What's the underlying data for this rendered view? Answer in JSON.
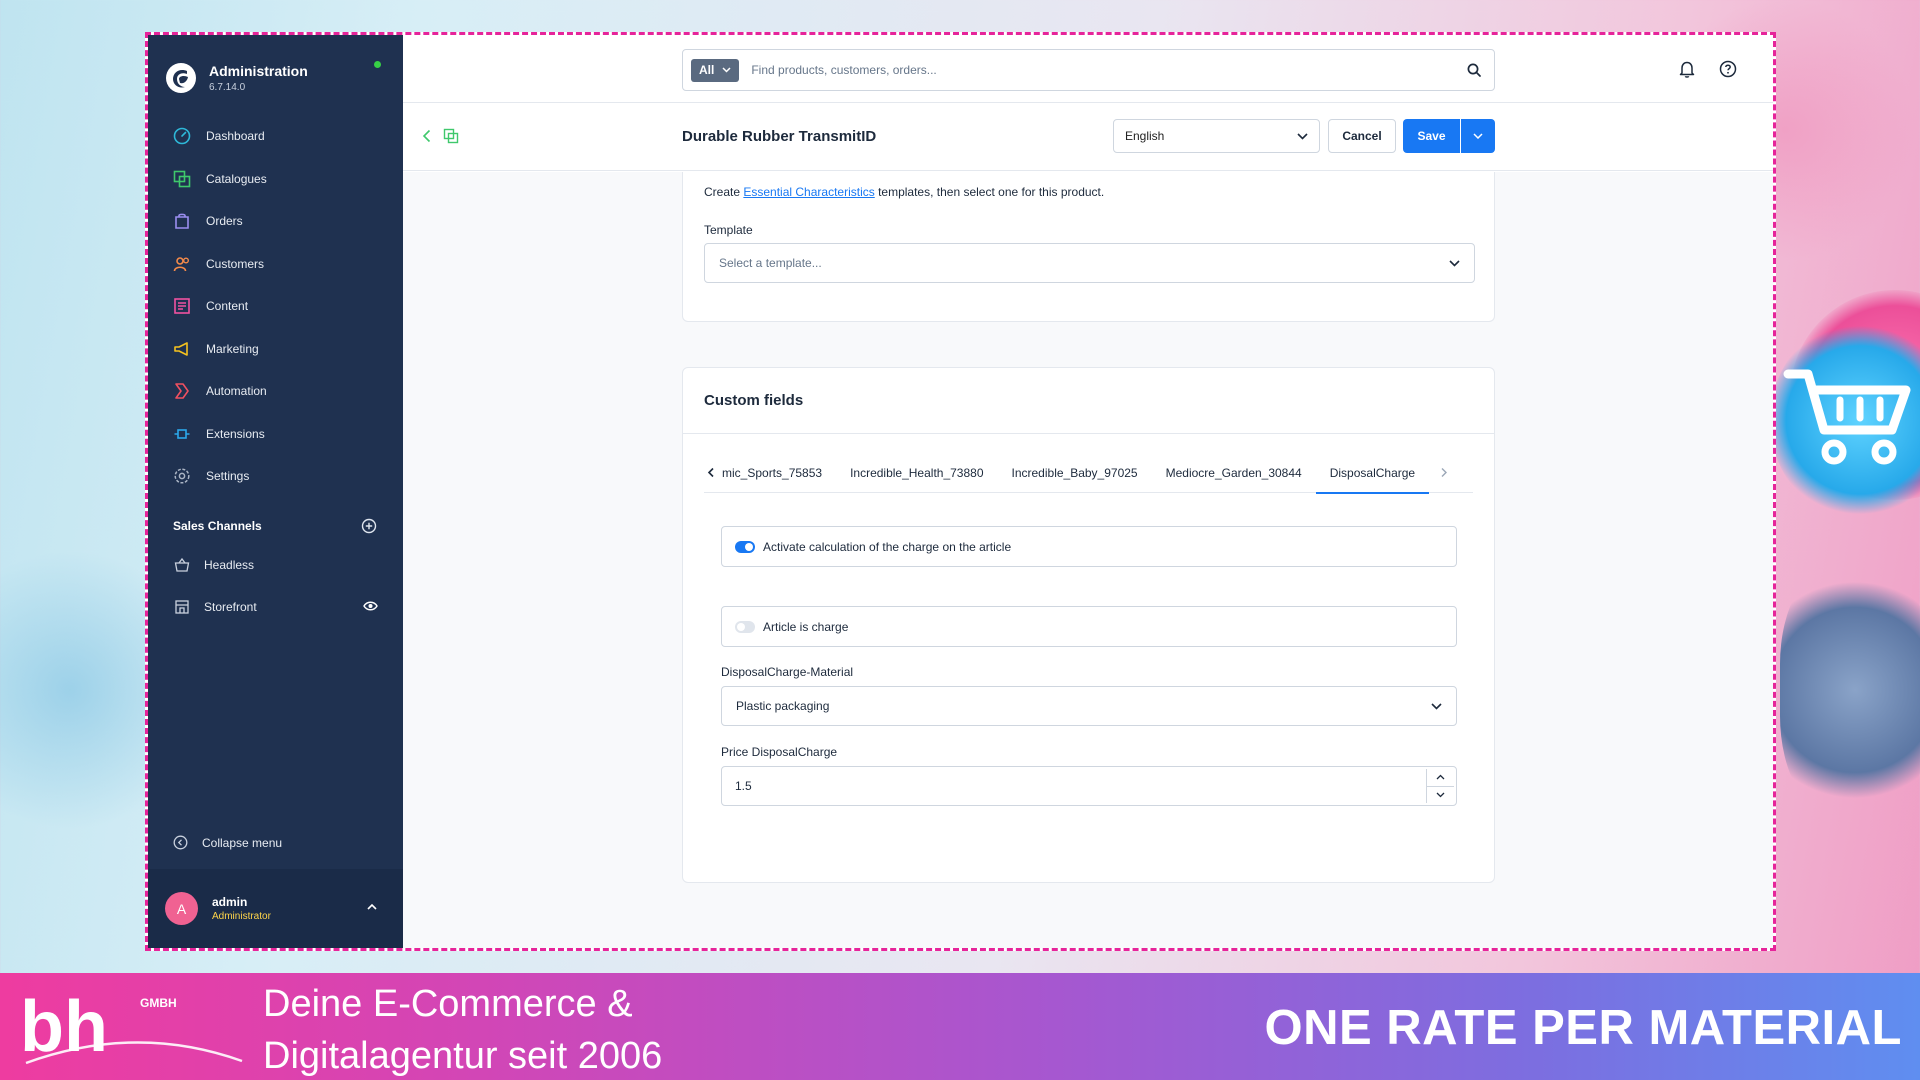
{
  "app": {
    "brand_title": "Administration",
    "version": "6.7.14.0"
  },
  "sidebar": {
    "items": [
      {
        "label": "Dashboard",
        "icon": "dashboard-icon",
        "color": "#2eb8d8"
      },
      {
        "label": "Catalogues",
        "icon": "catalogues-icon",
        "color": "#3fc86c"
      },
      {
        "label": "Orders",
        "icon": "orders-icon",
        "color": "#9a8ef0"
      },
      {
        "label": "Customers",
        "icon": "customers-icon",
        "color": "#f58b4a"
      },
      {
        "label": "Content",
        "icon": "content-icon",
        "color": "#f052a0"
      },
      {
        "label": "Marketing",
        "icon": "marketing-icon",
        "color": "#f5c21f"
      },
      {
        "label": "Automation",
        "icon": "automation-icon",
        "color": "#f05060"
      },
      {
        "label": "Extensions",
        "icon": "extensions-icon",
        "color": "#2ba8ec"
      },
      {
        "label": "Settings",
        "icon": "settings-icon",
        "color": "#aab4c4"
      }
    ],
    "sales_channels_title": "Sales Channels",
    "channels": [
      {
        "label": "Headless",
        "icon": "basket-icon"
      },
      {
        "label": "Storefront",
        "icon": "storefront-icon"
      }
    ],
    "collapse_label": "Collapse menu",
    "user": {
      "initial": "A",
      "name": "admin",
      "role": "Administrator"
    }
  },
  "topbar": {
    "search_scope": "All",
    "search_placeholder": "Find products, customers, orders..."
  },
  "subbar": {
    "title": "Durable Rubber TransmitID",
    "language": "English",
    "cancel_label": "Cancel",
    "save_label": "Save"
  },
  "essential": {
    "text_prefix": "Create ",
    "link_text": "Essential Characteristics",
    "text_suffix": " templates, then select one for this product.",
    "template_label": "Template",
    "template_placeholder": "Select a template..."
  },
  "custom_fields": {
    "title": "Custom fields",
    "tabs": [
      "mic_Sports_75853",
      "Incredible_Health_73880",
      "Incredible_Baby_97025",
      "Mediocre_Garden_30844",
      "DisposalCharge"
    ],
    "active_tab": "DisposalCharge",
    "activate_label": "Activate calculation of the charge on the article",
    "activate_on": true,
    "is_charge_label": "Article is charge",
    "is_charge_on": false,
    "material_label": "DisposalCharge-Material",
    "material_value": "Plastic packaging",
    "price_label": "Price DisposalCharge",
    "price_value": "1.5"
  },
  "banner": {
    "tagline_line1": "Deine E-Commerce &",
    "tagline_line2": "Digitalagentur seit 2006",
    "headline": "ONE RATE PER MATERIAL",
    "logo_text": "bh",
    "logo_sub": "GMBH"
  },
  "colors": {
    "sidebar_bg": "#1f3150",
    "accent": "#1878f3",
    "frame_border": "#e6249a",
    "status_dot": "#37d046"
  }
}
